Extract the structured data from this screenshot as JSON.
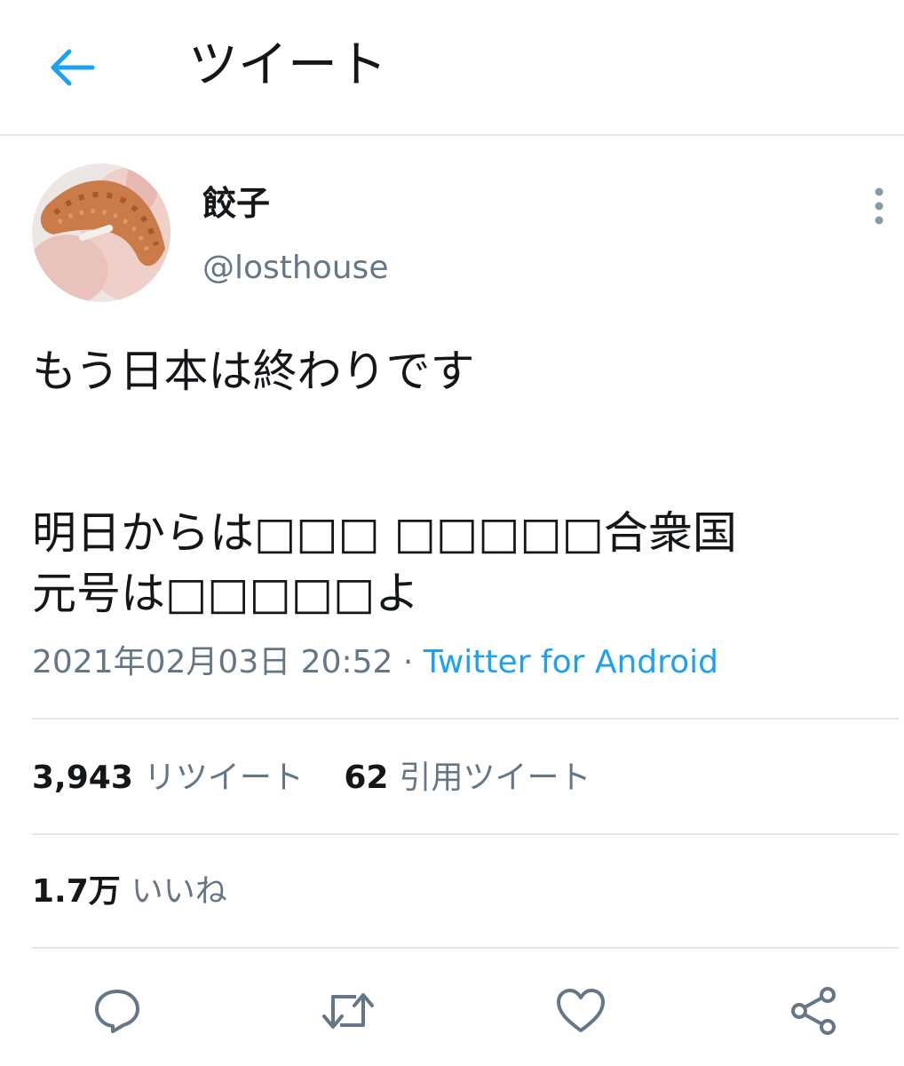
{
  "header": {
    "title": "ツイート",
    "back_icon": "arrow-left-icon",
    "accent_color": "#1da1f2"
  },
  "author": {
    "display_name": "餃子",
    "handle": "@losthouse",
    "avatar_description_icon": "avatar-image"
  },
  "tweet": {
    "lines": [
      "もう日本は終わりです",
      "",
      "明日からは□□□ □□□□□合衆国",
      "元号は□□□□□よ"
    ],
    "timestamp": "2021年02月03日 20:52",
    "separator": "·",
    "source": "Twitter for Android"
  },
  "stats": {
    "retweets_count": "3,943",
    "retweets_label": "リツイート",
    "quotes_count": "62",
    "quotes_label": "引用ツイート",
    "likes_count": "1.7万",
    "likes_label": "いいね"
  },
  "actions": [
    "reply-icon",
    "retweet-icon",
    "like-icon",
    "share-icon"
  ],
  "colors": {
    "text_primary": "#14171a",
    "text_secondary": "#657786",
    "divider": "#e1e8ed",
    "link": "#1da1f2"
  }
}
